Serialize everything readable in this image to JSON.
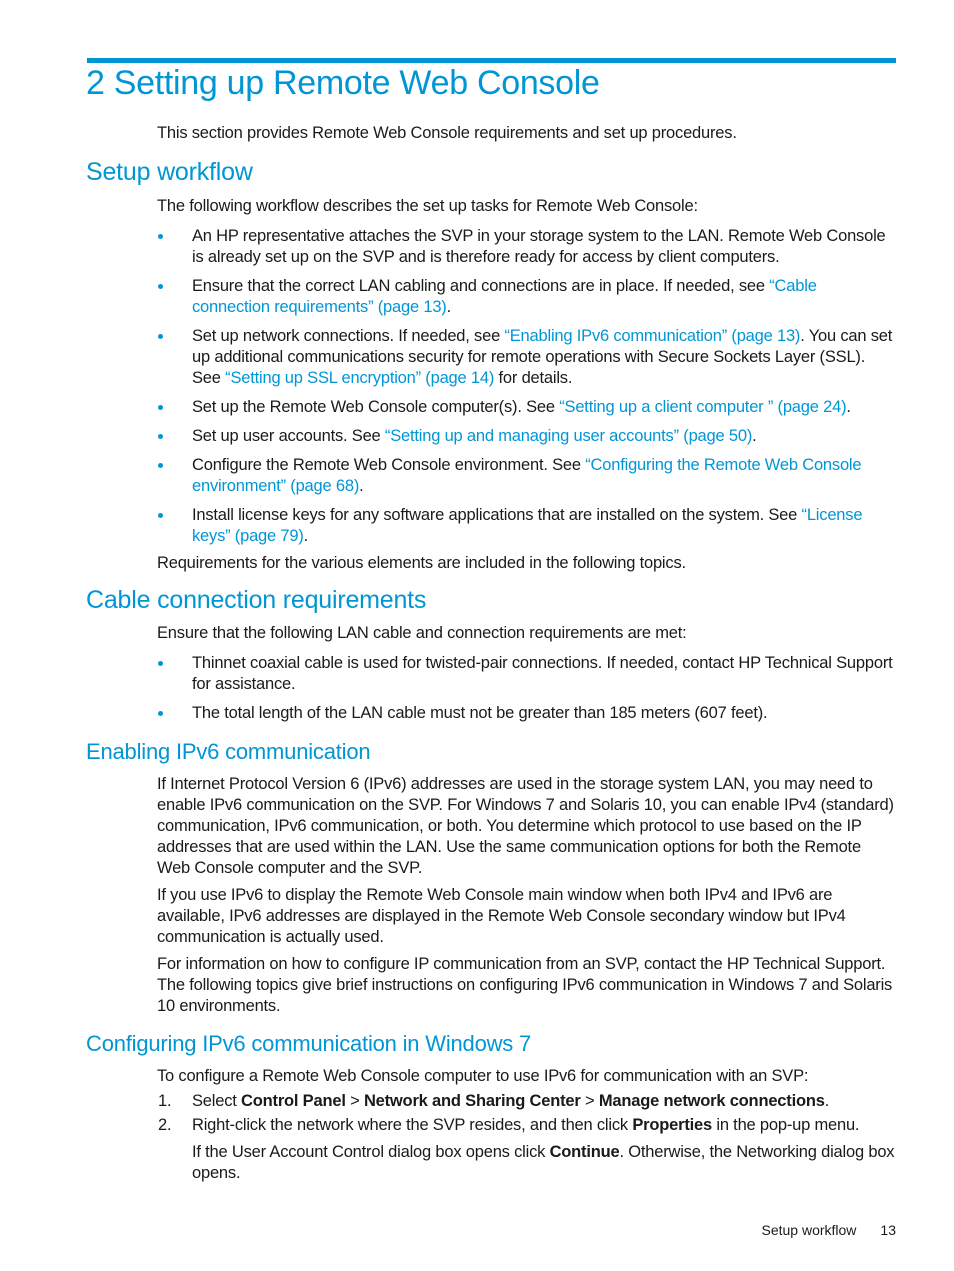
{
  "chapter": {
    "title": "2 Setting up Remote Web Console",
    "intro": "This section provides Remote Web Console requirements and set up procedures."
  },
  "setup_workflow": {
    "heading": "Setup workflow",
    "intro": "The following workflow describes the set up tasks for Remote Web Console:",
    "bullets": [
      {
        "pre": "An HP representative attaches the SVP in your storage system to the LAN. Remote Web Console is already set up on the SVP and is therefore ready for access by client computers.",
        "link": "",
        "post": ""
      },
      {
        "pre": "Ensure that the correct LAN cabling and connections are in place. If needed, see ",
        "link": "“Cable connection requirements” (page 13)",
        "post": "."
      },
      {
        "pre": "Set up network connections. If needed, see ",
        "link": "“Enabling IPv6 communication” (page 13)",
        "mid": ". You can set up additional communications security for remote operations with Secure Sockets Layer (SSL). See ",
        "link2": "“Setting up SSL encryption” (page 14)",
        "post": " for details."
      },
      {
        "pre": "Set up the Remote Web Console computer(s). See ",
        "link": "“Setting up a client computer ” (page 24)",
        "post": "."
      },
      {
        "pre": "Set up user accounts. See ",
        "link": "“Setting up and managing user accounts” (page 50)",
        "post": "."
      },
      {
        "pre": "Configure the Remote Web Console environment. See ",
        "link": "“Configuring the Remote Web Console environment” (page 68)",
        "post": "."
      },
      {
        "pre": "Install license keys for any software applications that are installed on the system. See ",
        "link": "“License keys” (page 79)",
        "post": "."
      }
    ],
    "outro": "Requirements for the various elements are included in the following topics."
  },
  "cable_requirements": {
    "heading": "Cable connection requirements",
    "intro": "Ensure that the following LAN cable and connection requirements are met:",
    "bullets": [
      "Thinnet coaxial cable is used for twisted-pair connections. If needed, contact HP Technical Support for assistance.",
      "The total length of the LAN cable must not be greater than 185 meters (607 feet)."
    ]
  },
  "enabling_ipv6": {
    "heading": "Enabling IPv6 communication",
    "paragraphs": [
      "If Internet Protocol Version 6 (IPv6) addresses are used in the storage system LAN, you may need to enable IPv6 communication on the SVP. For Windows 7 and Solaris 10, you can enable IPv4 (standard) communication, IPv6 communication, or both. You determine which protocol to use based on the IP addresses that are used within the LAN. Use the same communication options for both the Remote Web Console computer and the SVP.",
      "If you use IPv6 to display the Remote Web Console main window when both IPv4 and IPv6 are available, IPv6 addresses are displayed in the Remote Web Console secondary window but IPv4 communication is actually used.",
      "For information on how to configure IP communication from an SVP, contact the HP Technical Support. The following topics give brief instructions on configuring IPv6 communication in Windows 7 and Solaris 10 environments."
    ]
  },
  "configuring_win7": {
    "heading": "Configuring IPv6 communication in Windows 7",
    "intro": "To configure a Remote Web Console computer to use IPv6 for communication with an SVP:",
    "steps": [
      {
        "num": "1.",
        "t1": "Select ",
        "b1": "Control Panel",
        "t2": " > ",
        "b2": "Network and Sharing Center",
        "t3": " > ",
        "b3": "Manage network connections",
        "t4": "."
      },
      {
        "num": "2.",
        "t1": "Right-click the network where the SVP resides, and then click ",
        "b1": "Properties",
        "t2": " in the pop-up menu."
      }
    ],
    "note": {
      "t1": "If the User Account Control dialog box opens click ",
      "b1": "Continue",
      "t2": ". Otherwise, the Networking dialog box opens."
    }
  },
  "footer": {
    "section": "Setup workflow",
    "page": "13"
  }
}
